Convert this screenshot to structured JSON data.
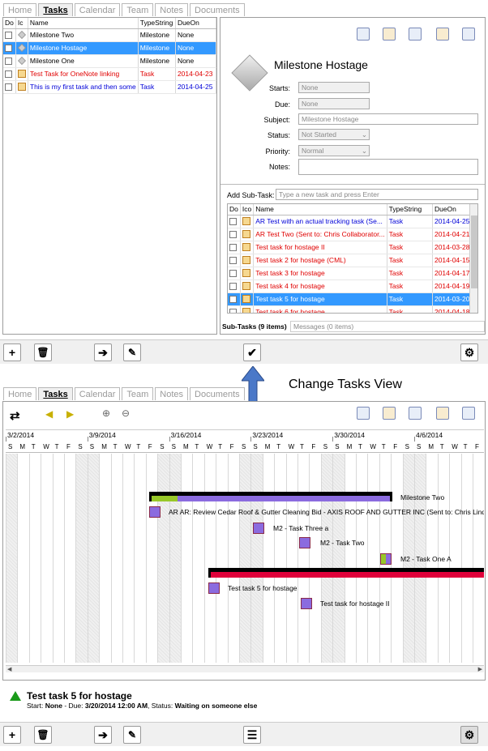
{
  "tabs": [
    "Home",
    "Tasks",
    "Calendar",
    "Team",
    "Notes",
    "Documents"
  ],
  "task_list": {
    "columns": [
      "Do",
      "Ic",
      "Name",
      "TypeString",
      "DueOn"
    ],
    "rows": [
      {
        "name": "Milestone Two",
        "type": "Milestone",
        "due": "None",
        "icon": "milestone-icon",
        "style": ""
      },
      {
        "name": "Milestone Hostage",
        "type": "Milestone",
        "due": "None",
        "icon": "milestone-icon",
        "style": "sel"
      },
      {
        "name": "Milestone One",
        "type": "Milestone",
        "due": "None",
        "icon": "milestone-icon",
        "style": ""
      },
      {
        "name": "Test Task for OneNote linking",
        "type": "Task",
        "due": "2014-04-23",
        "icon": "task-icon",
        "style": "red"
      },
      {
        "name": "This is my first task and then some",
        "type": "Task",
        "due": "2014-04-25",
        "icon": "task-icon",
        "style": "blue"
      }
    ]
  },
  "detail": {
    "title": "Milestone Hostage",
    "starts_label": "Starts:",
    "starts": "None",
    "due_label": "Due:",
    "due": "None",
    "subject_label": "Subject:",
    "subject": "Milestone Hostage",
    "status_label": "Status:",
    "status": "Not Started",
    "priority_label": "Priority:",
    "priority": "Normal",
    "notes_label": "Notes:",
    "notes": ""
  },
  "subtasks": {
    "add_label": "Add Sub-Task:",
    "add_placeholder": "Type a new task and press Enter",
    "columns": [
      "Do",
      "Ico",
      "Name",
      "TypeString",
      "DueOn"
    ],
    "rows": [
      {
        "name": "AR Test with an actual tracking task (Se...",
        "type": "Task",
        "due": "2014-04-25",
        "style": "blue"
      },
      {
        "name": "AR Test Two (Sent to: Chris Collaborator...",
        "type": "Task",
        "due": "2014-04-21",
        "style": "red"
      },
      {
        "name": "Test task for hostage II",
        "type": "Task",
        "due": "2014-03-28",
        "style": "red"
      },
      {
        "name": "Test task 2 for hostage (CML)",
        "type": "Task",
        "due": "2014-04-15",
        "style": "red"
      },
      {
        "name": "Test task 3 for hostage",
        "type": "Task",
        "due": "2014-04-17",
        "style": "red"
      },
      {
        "name": "Test task 4 for hostage",
        "type": "Task",
        "due": "2014-04-19",
        "style": "red"
      },
      {
        "name": "Test task 5 for hostage",
        "type": "Task",
        "due": "2014-03-20",
        "style": "sel"
      },
      {
        "name": "Test task 6 for hostage",
        "type": "Task",
        "due": "2014-04-18",
        "style": "red"
      }
    ],
    "tab_active": "Sub-Tasks (9 items)",
    "tab_inactive": "Messages (0 items)"
  },
  "annotation": "Change Tasks View",
  "gantt": {
    "weeks": [
      "3/2/2014",
      "3/9/2014",
      "3/16/2014",
      "3/23/2014",
      "3/30/2014",
      "4/6/2014"
    ],
    "days": [
      "S",
      "M",
      "T",
      "W",
      "T",
      "F",
      "S",
      "S",
      "M",
      "T",
      "W",
      "T",
      "F",
      "S",
      "S",
      "M",
      "T",
      "W",
      "T",
      "F",
      "S",
      "S",
      "M",
      "T",
      "W",
      "T",
      "F",
      "S",
      "S",
      "M",
      "T",
      "W",
      "T",
      "F",
      "S",
      "S",
      "M",
      "T",
      "W",
      "T",
      "F"
    ],
    "labels": {
      "milestone_two": "Milestone Two",
      "ar_review": "AR AR: Review Cedar Roof & Gutter Cleaning Bid - AXIS ROOF AND GUTTER INC (Sent to: Chris Lindst",
      "m2_three": "M2 - Task Three a",
      "m2_two": "M2 - Task Two",
      "m2_one": "M2 - Task One A",
      "task5": "Test task 5 for hostage",
      "task2": "Test task for hostage II"
    }
  },
  "status_panel": {
    "title": "Test task 5 for hostage",
    "start_label": "Start:",
    "start": "None",
    "due_label": "- Due:",
    "due": "3/20/2014 12:00 AM",
    "status_label": ", Status:",
    "status": "Waiting on someone else"
  },
  "colors": {
    "selection": "#3399ff",
    "red_text": "#e00000",
    "blue_text": "#0000d8",
    "bar_purple": "#8b6bdf",
    "bar_red": "#e0003a",
    "status_green": "#1a9a1a"
  }
}
